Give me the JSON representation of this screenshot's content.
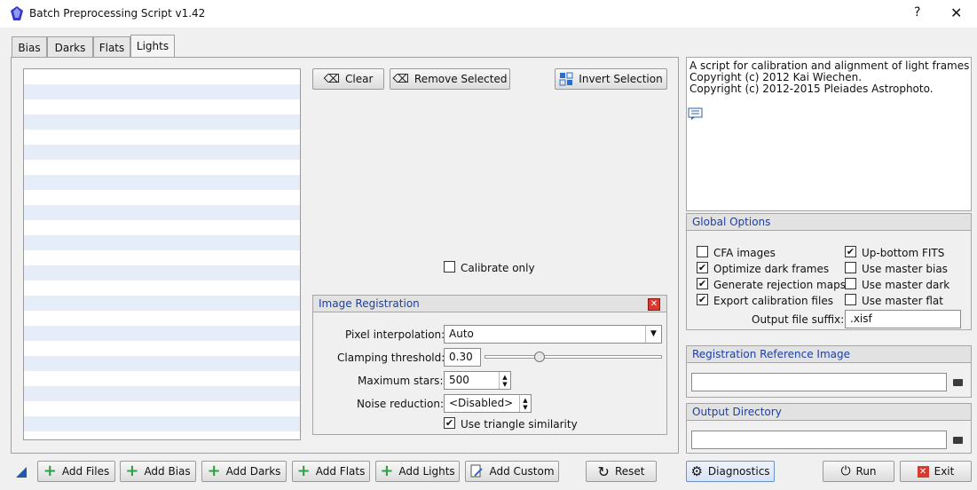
{
  "window": {
    "title": "Batch Preprocessing Script v1.42",
    "help": "?",
    "close": "✕"
  },
  "tabs": [
    {
      "label": "Bias"
    },
    {
      "label": "Darks"
    },
    {
      "label": "Flats"
    },
    {
      "label": "Lights"
    }
  ],
  "active_tab": "Lights",
  "list_buttons": {
    "clear": "Clear",
    "remove_selected": "Remove Selected",
    "invert_selection": "Invert Selection"
  },
  "calibrate_only": {
    "label": "Calibrate only",
    "checked": false
  },
  "image_registration": {
    "title": "Image Registration",
    "pixel_interpolation": {
      "label": "Pixel interpolation:",
      "value": "Auto"
    },
    "clamping_threshold": {
      "label": "Clamping threshold:",
      "value": "0.30"
    },
    "maximum_stars": {
      "label": "Maximum stars:",
      "value": "500"
    },
    "noise_reduction": {
      "label": "Noise reduction:",
      "value": "<Disabled>"
    },
    "use_triangle_similarity": {
      "label": "Use triangle similarity",
      "checked": true
    }
  },
  "info": {
    "line1": "A script for calibration and alignment of light frames",
    "line2": "Copyright (c) 2012 Kai Wiechen.",
    "line3": "Copyright (c) 2012-2015 Pleiades Astrophoto."
  },
  "global_options": {
    "title": "Global Options",
    "cfa_images": {
      "label": "CFA images",
      "checked": false
    },
    "up_bottom_fits": {
      "label": "Up-bottom FITS",
      "checked": true
    },
    "optimize_dark_frames": {
      "label": "Optimize dark frames",
      "checked": true
    },
    "use_master_bias": {
      "label": "Use master bias",
      "checked": false
    },
    "generate_rejection_maps": {
      "label": "Generate rejection maps",
      "checked": true
    },
    "use_master_dark": {
      "label": "Use master dark",
      "checked": false
    },
    "export_calibration_files": {
      "label": "Export calibration files",
      "checked": true
    },
    "use_master_flat": {
      "label": "Use master flat",
      "checked": false
    },
    "output_file_suffix": {
      "label": "Output file suffix:",
      "value": ".xisf"
    }
  },
  "registration_reference": {
    "title": "Registration Reference Image",
    "value": ""
  },
  "output_directory": {
    "title": "Output Directory",
    "value": ""
  },
  "bottom_buttons": {
    "add_files": "Add Files",
    "add_bias": "Add Bias",
    "add_darks": "Add Darks",
    "add_flats": "Add Flats",
    "add_lights": "Add Lights",
    "add_custom": "Add Custom",
    "reset": "Reset",
    "diagnostics": "Diagnostics",
    "run": "Run",
    "exit": "Exit"
  },
  "colors": {
    "accent": "#1a3fa8",
    "add_green": "#2fa043",
    "exit_red": "#d83a2f",
    "list_stripe": "#e6edfa"
  }
}
